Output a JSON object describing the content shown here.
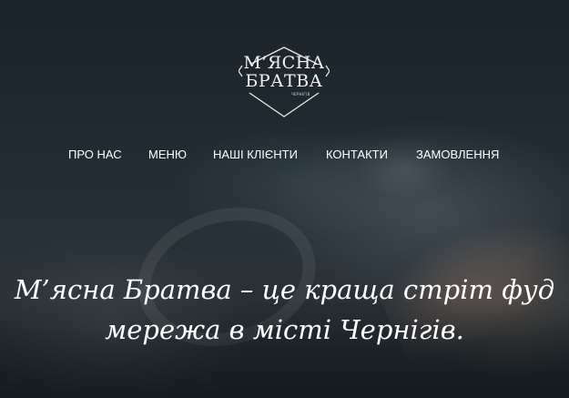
{
  "brand": {
    "logo_line1": "М’ЯСНА",
    "logo_line2": "БРАТВА",
    "logo_city": "ЧЕРНІГІВ"
  },
  "nav": {
    "items": [
      {
        "label": "ПРО НАС"
      },
      {
        "label": "МЕНЮ"
      },
      {
        "label": "НАШІ КЛІЄНТИ"
      },
      {
        "label": "КОНТАКТИ"
      },
      {
        "label": "ЗАМОВЛЕННЯ"
      }
    ]
  },
  "hero": {
    "headline_line1": "М’ясна Братва – це краща стріт фуд",
    "headline_line2": "мережа в місті Чернігів."
  },
  "colors": {
    "text": "#ffffff",
    "overlay": "#1c252b"
  }
}
